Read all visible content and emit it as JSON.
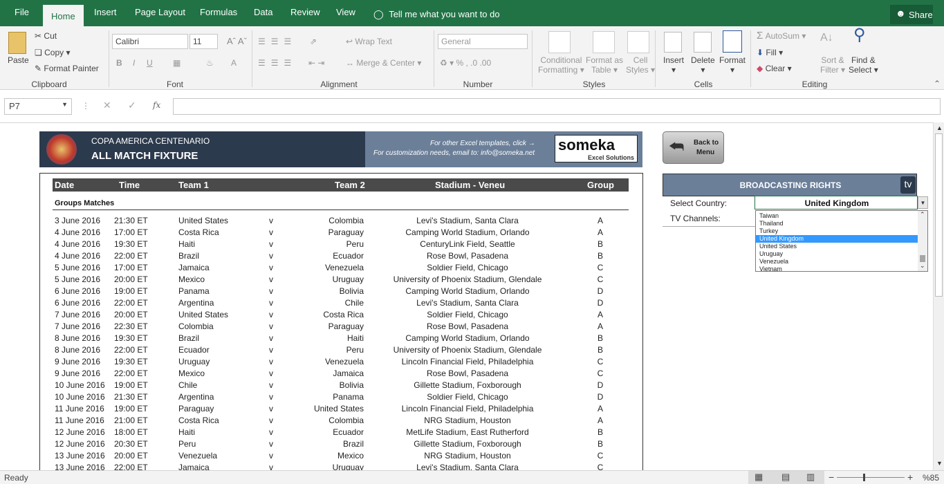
{
  "tabs": [
    "File",
    "Home",
    "Insert",
    "Page Layout",
    "Formulas",
    "Data",
    "Review",
    "View"
  ],
  "tell_me": "Tell me what you want to do",
  "share": "Share",
  "ribbon": {
    "paste": "Paste",
    "cut": "Cut",
    "copy": "Copy",
    "format_painter": "Format Painter",
    "font_name": "Calibri",
    "font_size": "11",
    "wrap_text": "Wrap Text",
    "merge_center": "Merge & Center",
    "number_format": "General",
    "cond_fmt_1": "Conditional",
    "cond_fmt_2": "Formatting",
    "fmt_table_1": "Format as",
    "fmt_table_2": "Table",
    "cell_styles_1": "Cell",
    "cell_styles_2": "Styles",
    "insert": "Insert",
    "delete": "Delete",
    "format": "Format",
    "autosum": "AutoSum",
    "fill": "Fill",
    "clear": "Clear",
    "sort_1": "Sort &",
    "sort_2": "Filter",
    "find_1": "Find &",
    "find_2": "Select",
    "groups": {
      "clipboard": "Clipboard",
      "font": "Font",
      "alignment": "Alignment",
      "number": "Number",
      "styles": "Styles",
      "cells": "Cells",
      "editing": "Editing"
    }
  },
  "formula_bar": {
    "name_box": "P7",
    "fx": "fx",
    "value": ""
  },
  "banner": {
    "line1": "COPA AMERICA CENTENARIO",
    "line2": "ALL MATCH FIXTURE",
    "info1": "For other Excel templates, click →",
    "info2": "For customization needs, email to: info@someka.net",
    "logo": "someka",
    "logo_sub": "Excel Solutions"
  },
  "back_button": {
    "line1": "Back to",
    "line2": "Menu"
  },
  "table": {
    "headers": [
      "Date",
      "Time",
      "Team 1",
      "Team 2",
      "Stadium - Veneu",
      "Group"
    ],
    "section": "Groups Matches",
    "rows": [
      [
        "3 June 2016",
        "21:30 ET",
        "United States",
        "v",
        "Colombia",
        "Levi's Stadium, Santa Clara",
        "A"
      ],
      [
        "4 June 2016",
        "17:00 ET",
        "Costa Rica",
        "v",
        "Paraguay",
        "Camping World Stadium, Orlando",
        "A"
      ],
      [
        "4 June 2016",
        "19:30 ET",
        "Haiti",
        "v",
        "Peru",
        "CenturyLink Field, Seattle",
        "B"
      ],
      [
        "4 June 2016",
        "22:00 ET",
        "Brazil",
        "v",
        "Ecuador",
        "Rose Bowl, Pasadena",
        "B"
      ],
      [
        "5 June 2016",
        "17:00 ET",
        "Jamaica",
        "v",
        "Venezuela",
        "Soldier Field, Chicago",
        "C"
      ],
      [
        "5 June 2016",
        "20:00 ET",
        "Mexico",
        "v",
        "Uruguay",
        "University of Phoenix Stadium, Glendale",
        "C"
      ],
      [
        "6 June 2016",
        "19:00 ET",
        "Panama",
        "v",
        "Bolivia",
        "Camping World Stadium, Orlando",
        "D"
      ],
      [
        "6 June 2016",
        "22:00 ET",
        "Argentina",
        "v",
        "Chile",
        "Levi's Stadium, Santa Clara",
        "D"
      ],
      [
        "7 June 2016",
        "20:00 ET",
        "United States",
        "v",
        "Costa Rica",
        "Soldier Field, Chicago",
        "A"
      ],
      [
        "7 June 2016",
        "22:30 ET",
        "Colombia",
        "v",
        "Paraguay",
        "Rose Bowl, Pasadena",
        "A"
      ],
      [
        "8 June 2016",
        "19:30 ET",
        "Brazil",
        "v",
        "Haiti",
        "Camping World Stadium, Orlando",
        "B"
      ],
      [
        "8 June 2016",
        "22:00 ET",
        "Ecuador",
        "v",
        "Peru",
        "University of Phoenix Stadium, Glendale",
        "B"
      ],
      [
        "9 June 2016",
        "19:30 ET",
        "Uruguay",
        "v",
        "Venezuela",
        "Lincoln Financial Field, Philadelphia",
        "C"
      ],
      [
        "9 June 2016",
        "22:00 ET",
        "Mexico",
        "v",
        "Jamaica",
        "Rose Bowl, Pasadena",
        "C"
      ],
      [
        "10 June 2016",
        "19:00 ET",
        "Chile",
        "v",
        "Bolivia",
        "Gillette Stadium, Foxborough",
        "D"
      ],
      [
        "10 June 2016",
        "21:30 ET",
        "Argentina",
        "v",
        "Panama",
        "Soldier Field, Chicago",
        "D"
      ],
      [
        "11 June 2016",
        "19:00 ET",
        "Paraguay",
        "v",
        "United States",
        "Lincoln Financial Field, Philadelphia",
        "A"
      ],
      [
        "11 June 2016",
        "21:00 ET",
        "Costa Rica",
        "v",
        "Colombia",
        "NRG Stadium, Houston",
        "A"
      ],
      [
        "12 June 2016",
        "18:00 ET",
        "Haiti",
        "v",
        "Ecuador",
        "MetLife Stadium, East Rutherford",
        "B"
      ],
      [
        "12 June 2016",
        "20:30 ET",
        "Peru",
        "v",
        "Brazil",
        "Gillette Stadium, Foxborough",
        "B"
      ],
      [
        "13 June 2016",
        "20:00 ET",
        "Venezuela",
        "v",
        "Mexico",
        "NRG Stadium, Houston",
        "C"
      ],
      [
        "13 June 2016",
        "22:00 ET",
        "Jamaica",
        "v",
        "Uruguay",
        "Levi's Stadium, Santa Clara",
        "C"
      ]
    ]
  },
  "broadcast": {
    "title": "BROADCASTING RIGHTS",
    "tv_icon": "tv",
    "select_label": "Select Country:",
    "selected": "United Kingdom",
    "channels_label": "TV Channels:",
    "options": [
      "Taiwan",
      "Thailand",
      "Turkey",
      "United Kingdom",
      "United States",
      "Uruguay",
      "Venezuela",
      "Vietnam"
    ]
  },
  "status": {
    "ready": "Ready",
    "zoom": "%85"
  }
}
